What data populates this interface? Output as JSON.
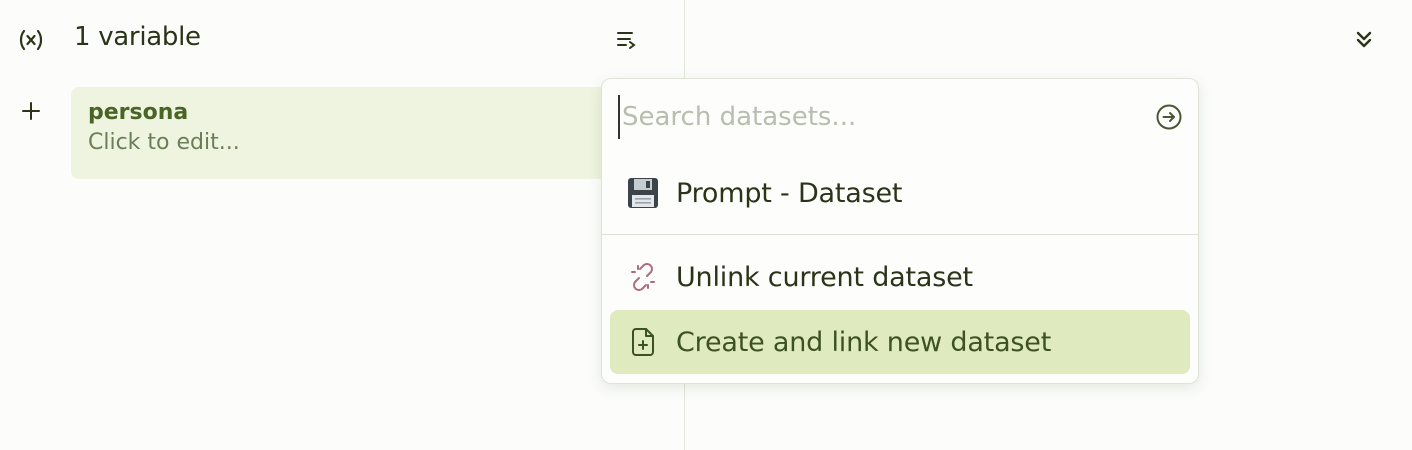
{
  "variables_panel": {
    "variable_icon": "variable-icon",
    "count_label": "1 variable",
    "wrap_icon": "wrap-lines-icon",
    "add_icon": "plus-icon",
    "variables": [
      {
        "name": "persona",
        "value_placeholder": "Click to edit..."
      }
    ]
  },
  "right_panel": {
    "collapse_icon": "chevrons-down-icon"
  },
  "dataset_menu": {
    "search_placeholder": "Search datasets...",
    "search_value": "",
    "go_icon": "arrow-right-circle-icon",
    "items": [
      {
        "label": "Prompt - Dataset",
        "icon": "floppy-disk-icon"
      },
      {
        "label": "Unlink current dataset",
        "icon": "unlink-icon",
        "icon_color": "#b06a7f"
      },
      {
        "label": "Create and link new dataset",
        "icon": "file-plus-icon",
        "highlight_color": "#dfeabf"
      }
    ]
  }
}
